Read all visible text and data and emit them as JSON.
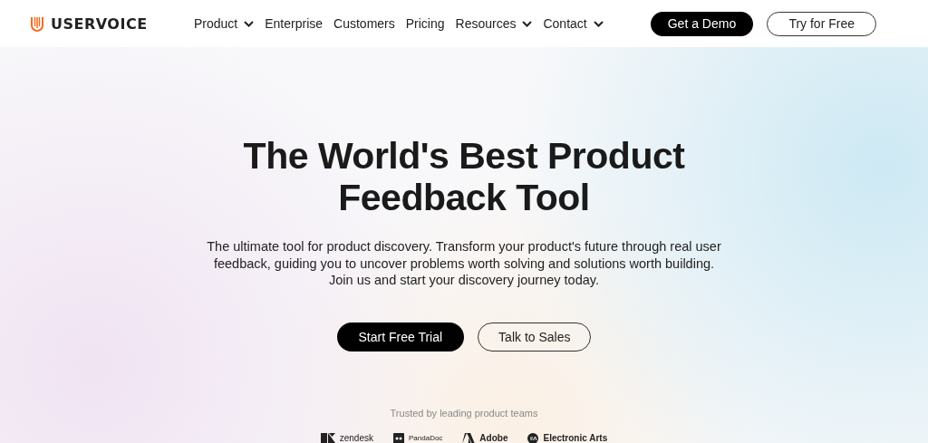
{
  "header": {
    "brand": "USERVOICE",
    "nav": [
      {
        "label": "Product",
        "has_menu": true
      },
      {
        "label": "Enterprise",
        "has_menu": false
      },
      {
        "label": "Customers",
        "has_menu": false
      },
      {
        "label": "Pricing",
        "has_menu": false
      },
      {
        "label": "Resources",
        "has_menu": true
      },
      {
        "label": "Contact",
        "has_menu": true
      }
    ],
    "buttons": [
      {
        "label": "Get a Demo",
        "kind": "filled"
      },
      {
        "label": "Try for Free",
        "kind": "outline"
      }
    ]
  },
  "hero": {
    "title_lines": [
      "The World's Best Product",
      "Feedback Tool"
    ],
    "description": [
      "The ultimate tool for product discovery. Transform your product's future through real user",
      "feedback, guiding you to uncover problems worth solving and solutions worth building.",
      "Join us and start your discovery journey today."
    ],
    "buttons": [
      {
        "label": "Start Free Trial",
        "kind": "filled"
      },
      {
        "label": "Talk to Sales",
        "kind": "outline"
      }
    ]
  },
  "trusted": {
    "caption": "Trusted by leading product teams",
    "logos": [
      {
        "kind": "zendesk",
        "name": "zendesk"
      },
      {
        "kind": "pandadoc",
        "name": "PandaDoc"
      },
      {
        "kind": "adobe",
        "name": "Adobe"
      },
      {
        "kind": "ea",
        "name": "Electronic Arts"
      }
    ]
  }
}
